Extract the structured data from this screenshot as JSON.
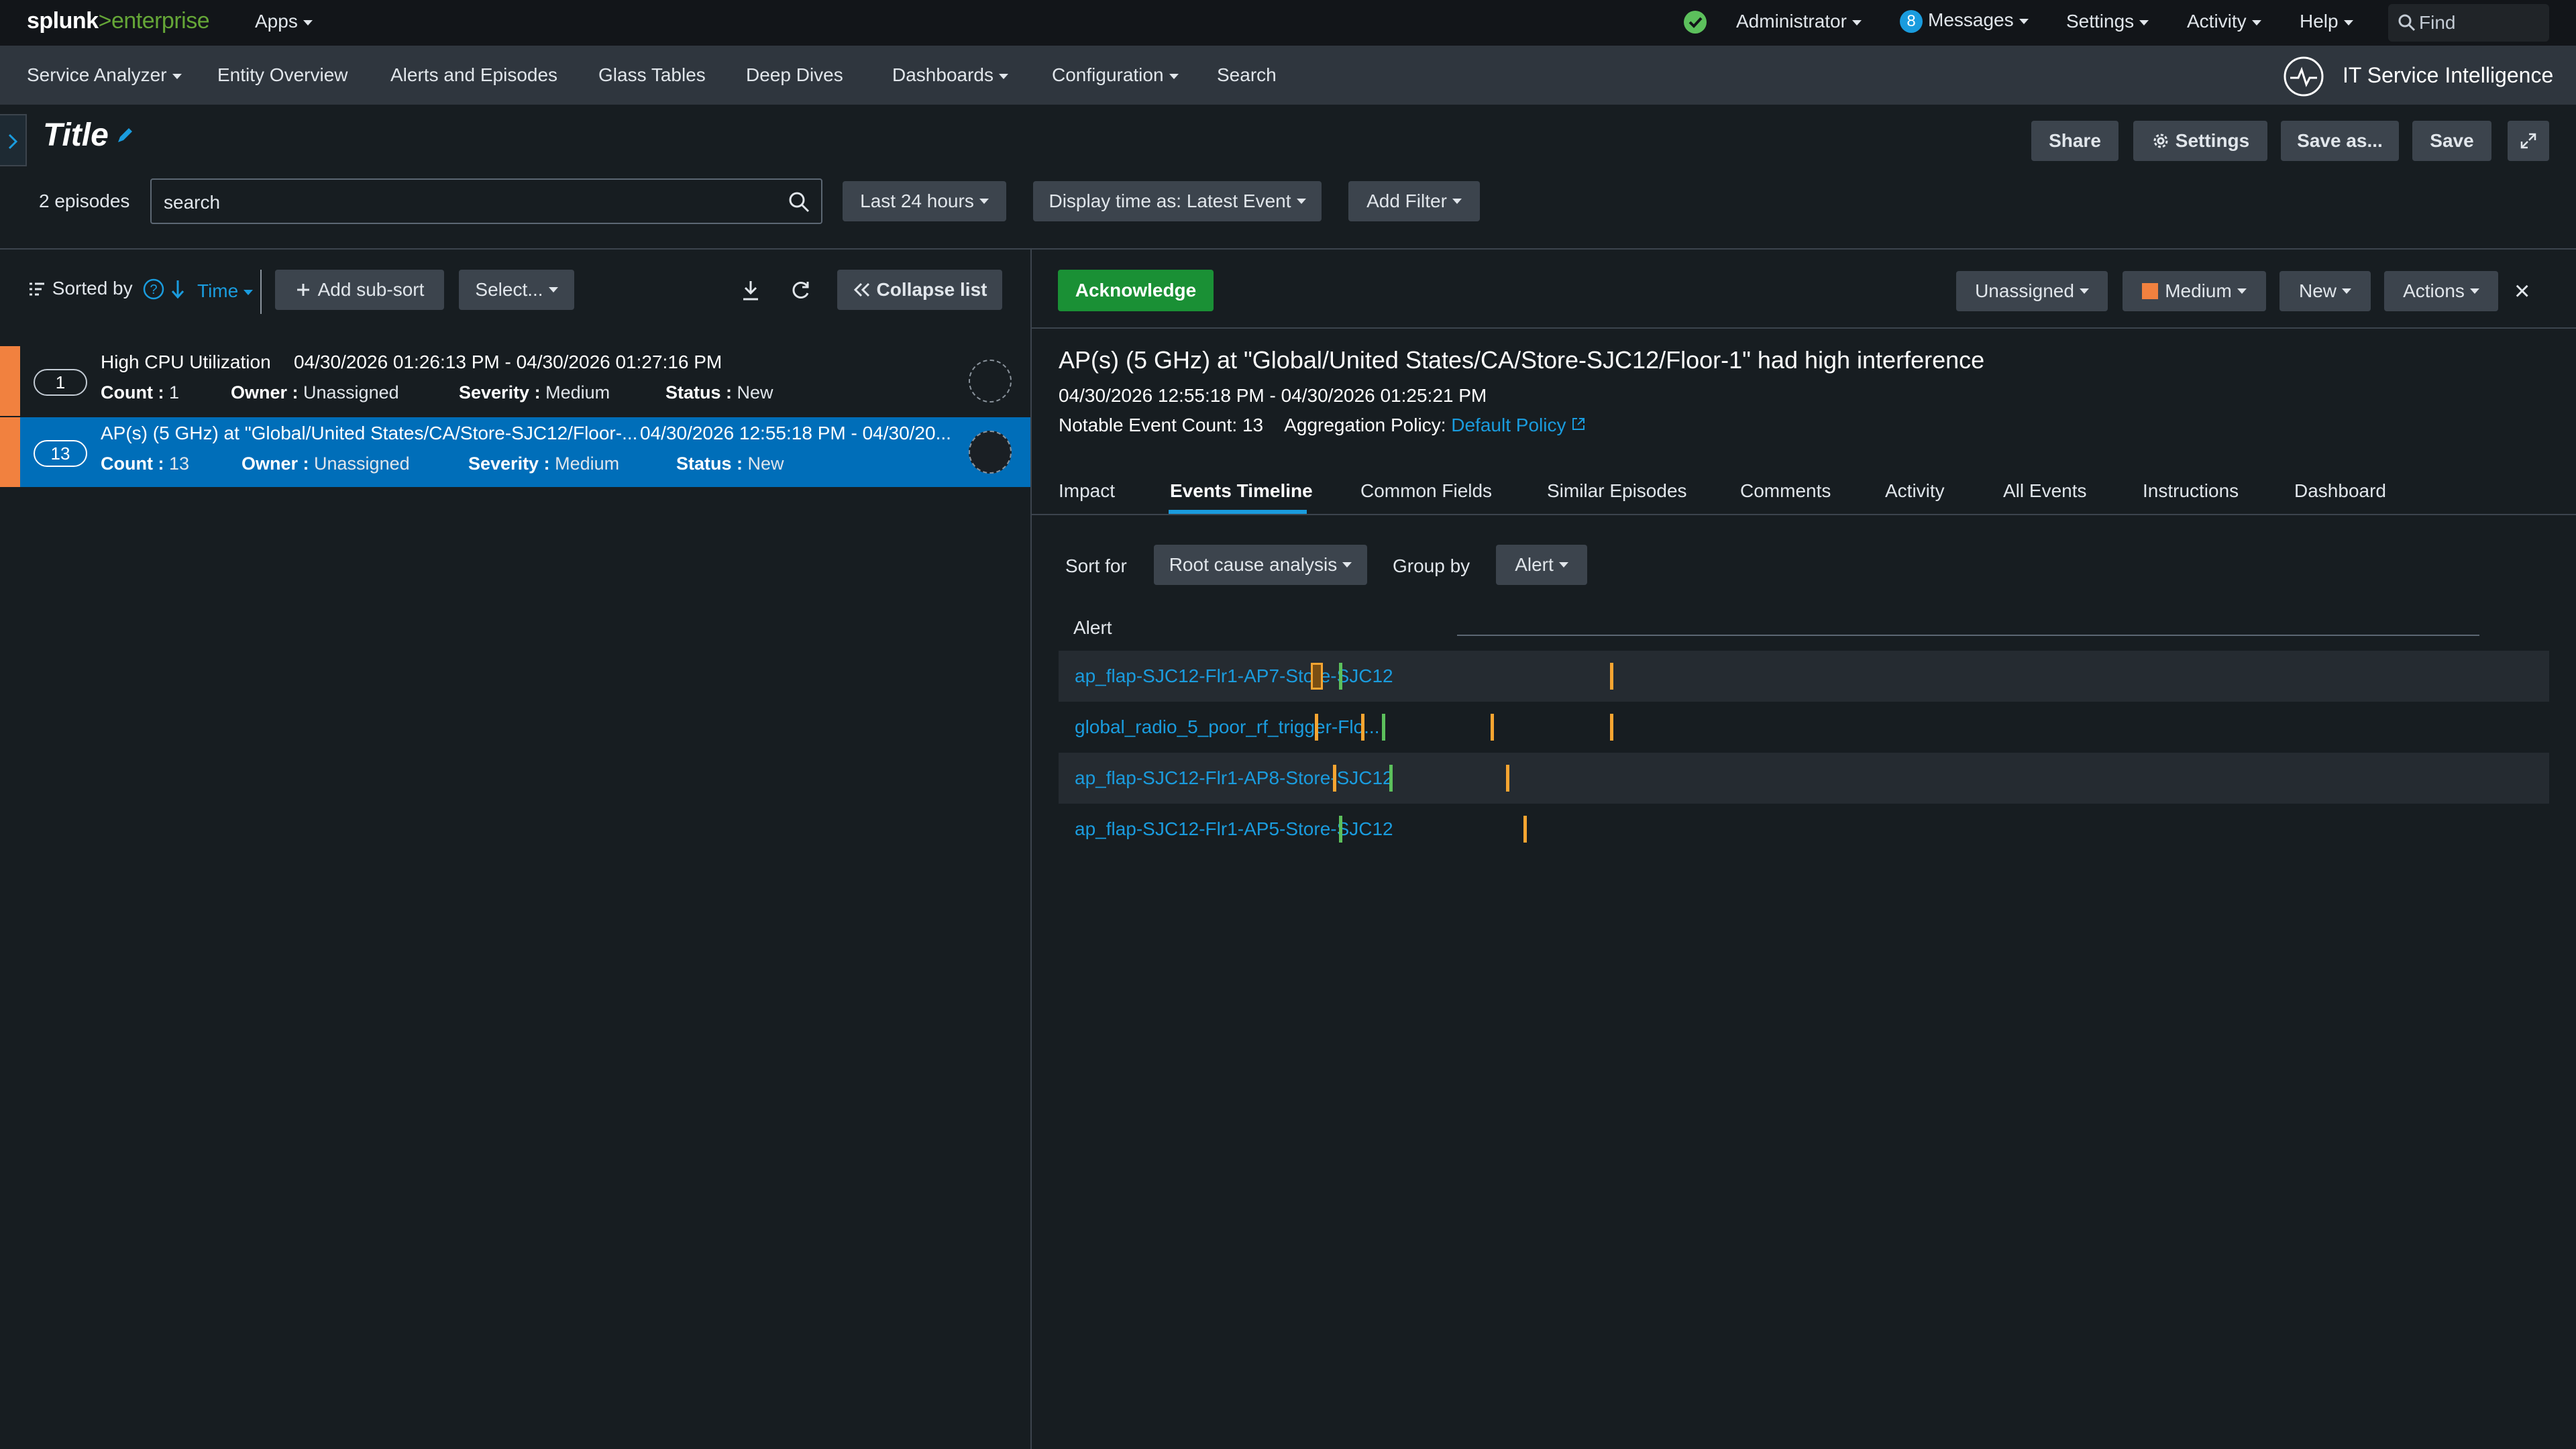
{
  "topbar": {
    "logo_splunk": "splunk",
    "logo_gt": ">",
    "logo_product": "enterprise",
    "apps": "Apps",
    "administrator": "Administrator",
    "messages_count": "8",
    "messages": "Messages",
    "settings": "Settings",
    "activity": "Activity",
    "help": "Help",
    "find_placeholder": "Find"
  },
  "nav": {
    "items": [
      "Service Analyzer",
      "Entity Overview",
      "Alerts and Episodes",
      "Glass Tables",
      "Deep Dives",
      "Dashboards",
      "Configuration",
      "Search"
    ],
    "app_title": "IT Service Intelligence"
  },
  "header": {
    "title": "Title",
    "share": "Share",
    "settings": "Settings",
    "save_as": "Save as...",
    "save": "Save"
  },
  "filters": {
    "episodes_count": "2 episodes",
    "search_value": "search",
    "time_range": "Last 24 hours",
    "display_time": "Display time as: Latest Event",
    "add_filter": "Add Filter"
  },
  "list_toolbar": {
    "sorted_by": "Sorted by",
    "sort_field": "Time",
    "add_sub_sort": "Add sub-sort",
    "select": "Select...",
    "collapse": "Collapse list"
  },
  "episodes": [
    {
      "count": "1",
      "title": "High CPU Utilization",
      "time": "04/30/2026 01:26:13 PM - 04/30/2026 01:27:16 PM",
      "count_label": "Count :",
      "count_value": "1",
      "owner_label": "Owner :",
      "owner": "Unassigned",
      "severity_label": "Severity :",
      "severity": "Medium",
      "status_label": "Status :",
      "status": "New"
    },
    {
      "count": "13",
      "title": "AP(s) (5 GHz) at \"Global/United States/CA/Store-SJC12/Floor-...",
      "time": "04/30/2026 12:55:18 PM - 04/30/20...",
      "count_label": "Count :",
      "count_value": "13",
      "owner_label": "Owner :",
      "owner": "Unassigned",
      "severity_label": "Severity :",
      "severity": "Medium",
      "status_label": "Status :",
      "status": "New"
    }
  ],
  "detail": {
    "acknowledge": "Acknowledge",
    "owner": "Unassigned",
    "severity": "Medium",
    "status": "New",
    "actions": "Actions",
    "close": "×",
    "title": "AP(s) (5 GHz) at \"Global/United States/CA/Store-SJC12/Floor-1\" had high interference",
    "time": "04/30/2026 12:55:18 PM - 04/30/2026 01:25:21 PM",
    "notable_count": "Notable Event Count: 13",
    "agg_label": "Aggregation Policy:",
    "agg_policy": "Default Policy",
    "tabs": [
      "Impact",
      "Events Timeline",
      "Common Fields",
      "Similar Episodes",
      "Comments",
      "Activity",
      "All Events",
      "Instructions",
      "Dashboard"
    ],
    "active_tab": "Events Timeline",
    "sort_for_label": "Sort for",
    "sort_for_value": "Root cause analysis",
    "group_by_label": "Group by",
    "group_by_value": "Alert",
    "column_header": "Alert"
  },
  "timeline": {
    "colors": {
      "orange": "#f8a531",
      "green": "#5cc05c"
    },
    "rows": [
      {
        "name": "ap_flap-SJC12-Flr1-AP7-Store-SJC12",
        "marks": [
          {
            "t": 0.172,
            "c": "orange",
            "hl": true
          },
          {
            "t": 0.188,
            "c": "green"
          },
          {
            "t": 0.37,
            "c": "orange"
          }
        ]
      },
      {
        "name": "global_radio_5_poor_rf_trigger-Flo...",
        "marks": [
          {
            "t": 0.172,
            "c": "orange"
          },
          {
            "t": 0.203,
            "c": "orange"
          },
          {
            "t": 0.217,
            "c": "green"
          },
          {
            "t": 0.29,
            "c": "orange"
          },
          {
            "t": 0.37,
            "c": "orange"
          }
        ]
      },
      {
        "name": "ap_flap-SJC12-Flr1-AP8-Store-SJC12",
        "marks": [
          {
            "t": 0.184,
            "c": "orange"
          },
          {
            "t": 0.222,
            "c": "green"
          },
          {
            "t": 0.3,
            "c": "orange"
          }
        ]
      },
      {
        "name": "ap_flap-SJC12-Flr1-AP5-Store-SJC12",
        "marks": [
          {
            "t": 0.188,
            "c": "green"
          },
          {
            "t": 0.312,
            "c": "orange"
          }
        ]
      }
    ]
  }
}
